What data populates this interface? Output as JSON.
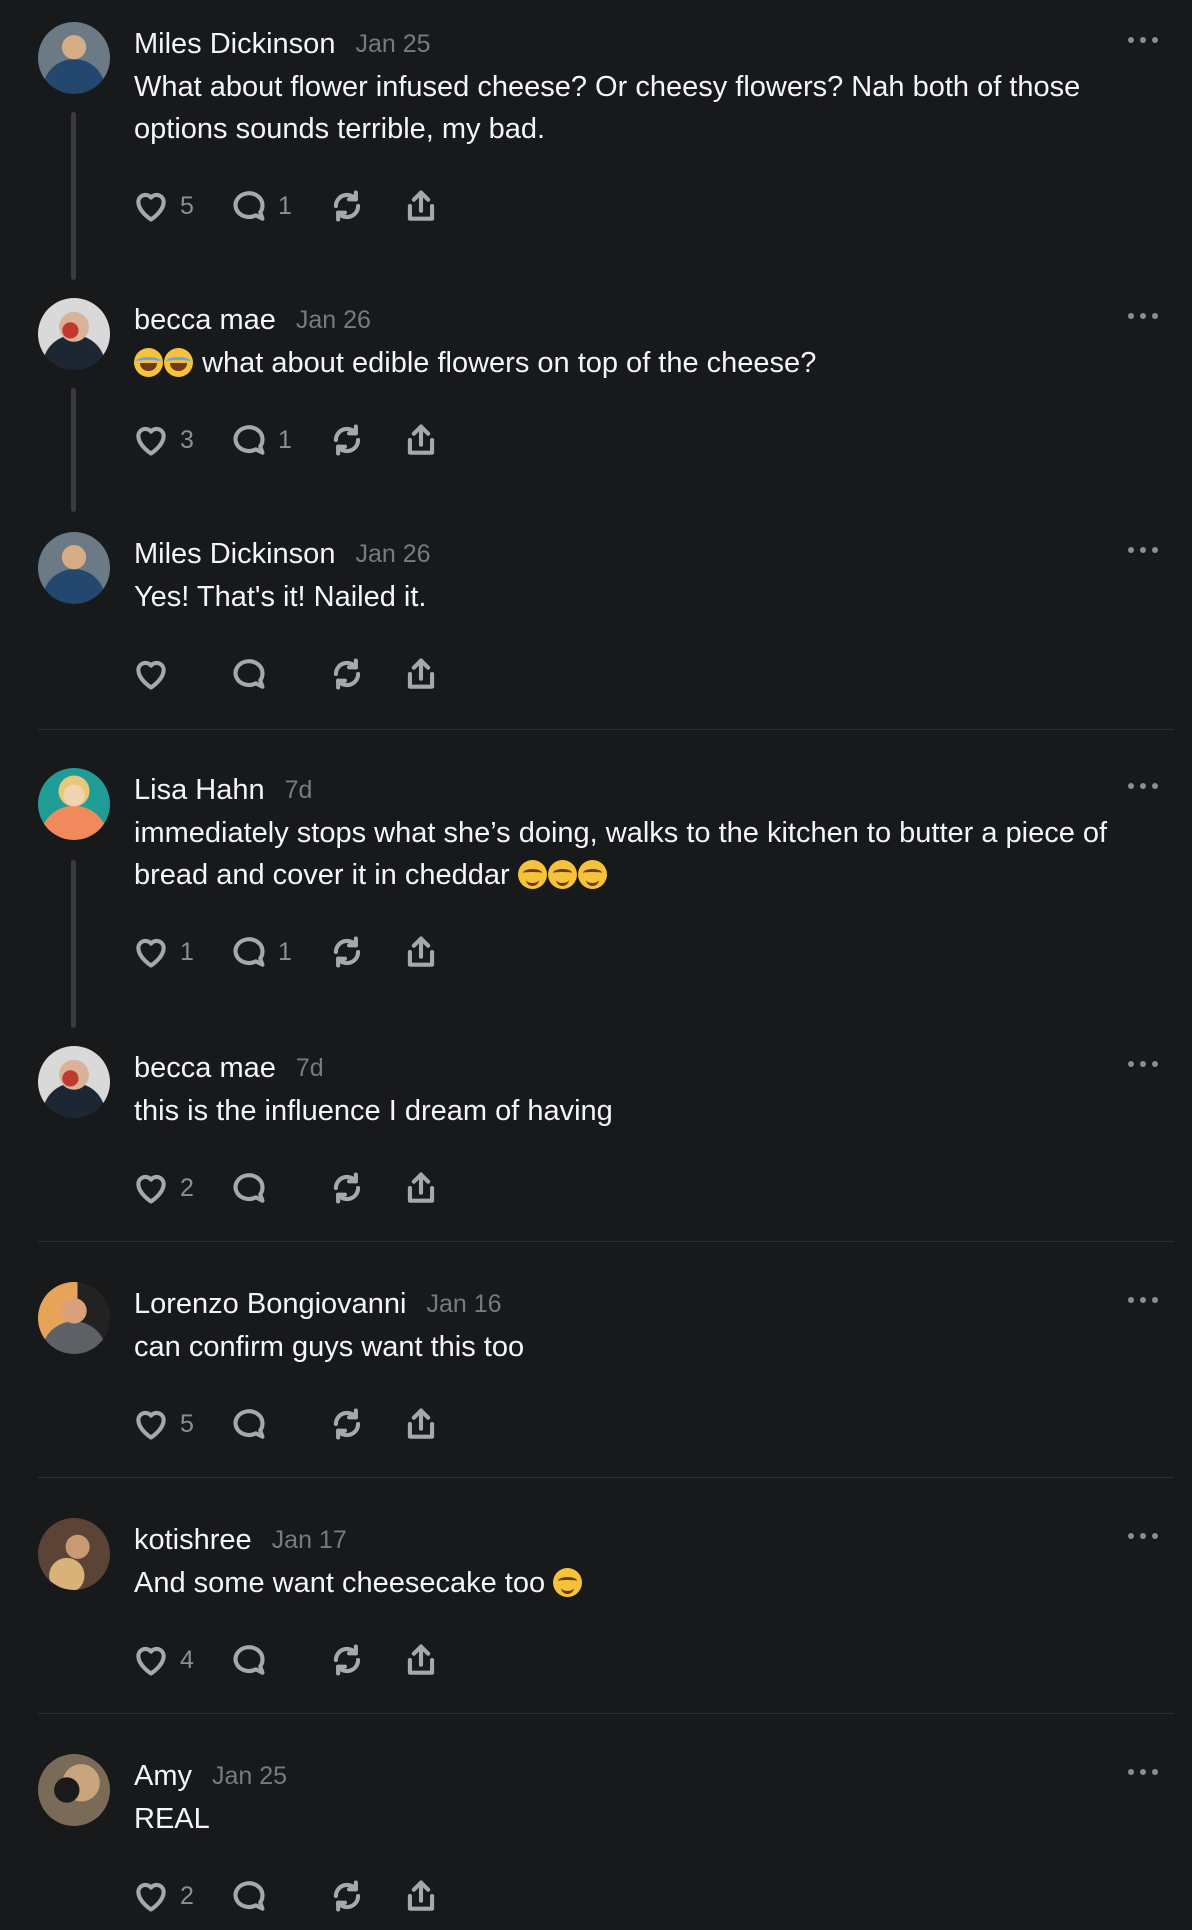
{
  "posts": [
    {
      "name": "Miles Dickinson",
      "time": "Jan 25",
      "text": "What about flower infused cheese? Or cheesy flowers? Nah both of those options sounds terrible, my bad.",
      "likes": "5",
      "replies": "1",
      "avatar_colors": [
        "#2f4a6b",
        "#c9a27a"
      ]
    },
    {
      "name": "becca mae",
      "time": "Jan 26",
      "text_pre_emoji": "😂😂",
      "text": "what about edible flowers on top of the cheese?",
      "likes": "3",
      "replies": "1",
      "avatar_colors": [
        "#cfcfcf",
        "#c0392b"
      ]
    },
    {
      "name": "Miles Dickinson",
      "time": "Jan 26",
      "text": "Yes! That's it! Nailed it.",
      "likes": "",
      "replies": "",
      "avatar_colors": [
        "#2f4a6b",
        "#c9a27a"
      ]
    },
    {
      "name": "Lisa Hahn",
      "time": "7d",
      "text": "immediately stops what she’s doing, walks to the kitchen to butter a piece of bread and cover it in cheddar",
      "text_post_emoji": "😌😌😌",
      "likes": "1",
      "replies": "1",
      "avatar_colors": [
        "#1e9c95",
        "#f08a5d"
      ]
    },
    {
      "name": "becca mae",
      "time": "7d",
      "text": "this is the influence I dream of having",
      "likes": "2",
      "replies": "",
      "avatar_colors": [
        "#cfcfcf",
        "#c0392b"
      ]
    },
    {
      "name": "Lorenzo Bongiovanni",
      "time": "Jan 16",
      "text": "can confirm guys want this too",
      "likes": "5",
      "replies": "",
      "avatar_colors": [
        "#e8a35a",
        "#2b2b2b"
      ]
    },
    {
      "name": "kotishree",
      "time": "Jan 17",
      "text": "And some want cheesecake too",
      "text_post_emoji": "😌",
      "likes": "4",
      "replies": "",
      "avatar_colors": [
        "#6b4c3b",
        "#d9b27a"
      ]
    },
    {
      "name": "Amy",
      "time": "Jan 25",
      "text": "REAL",
      "likes": "2",
      "replies": "",
      "avatar_colors": [
        "#8a6a4a",
        "#1a1a1a"
      ]
    }
  ],
  "icons": {
    "like": "heart-icon",
    "reply": "comment-icon",
    "repost": "repost-icon",
    "share": "share-icon",
    "more": "more-icon"
  },
  "colors": {
    "background": "#18191b",
    "text": "#f3f5f7",
    "muted": "#777a80"
  }
}
